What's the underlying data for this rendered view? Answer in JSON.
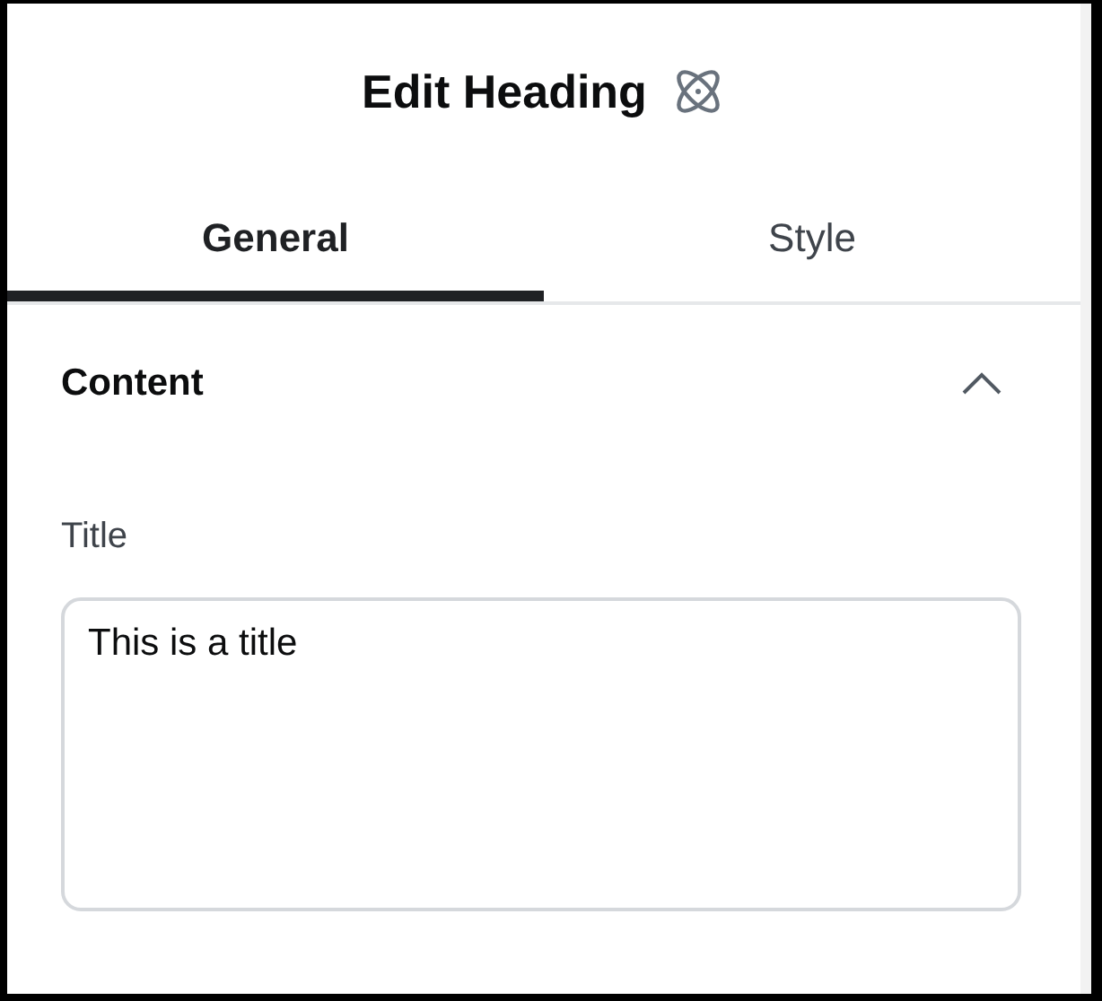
{
  "header": {
    "title": "Edit Heading"
  },
  "tabs": [
    {
      "label": "General",
      "selected": true
    },
    {
      "label": "Style",
      "selected": false
    }
  ],
  "section": {
    "title": "Content",
    "expanded": true,
    "field": {
      "label": "Title",
      "value": "This is a title"
    }
  }
}
